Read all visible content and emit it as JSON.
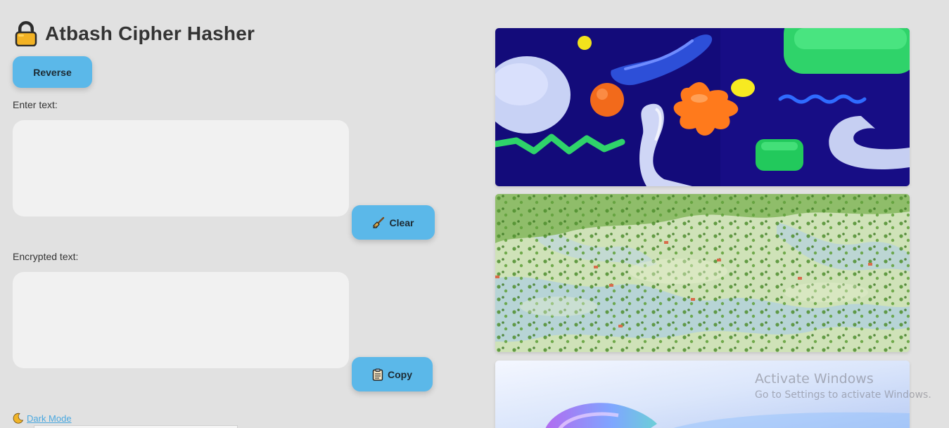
{
  "app": {
    "title": "Atbash Cipher Hasher",
    "icon": "lock-icon"
  },
  "buttons": {
    "reverse_label": "Reverse",
    "clear_label": "Clear",
    "clear_icon": "broom-icon",
    "copy_label": "Copy",
    "copy_icon": "clipboard-icon"
  },
  "input": {
    "label": "Enter text:",
    "value": "",
    "placeholder": ""
  },
  "output": {
    "label": "Encrypted text:",
    "value": "",
    "placeholder": ""
  },
  "dark_mode": {
    "icon": "moon-icon",
    "label": "Dark Mode"
  },
  "gallery": {
    "images": [
      {
        "name": "abstract-3d-shapes-image"
      },
      {
        "name": "landscape-hills-image"
      },
      {
        "name": "gradient-swirl-image"
      }
    ]
  },
  "watermark": {
    "title": "Activate Windows",
    "subtitle": "Go to Settings to activate Windows."
  },
  "colors": {
    "background": "#e1e1e1",
    "button": "#5bb8e9",
    "textbox": "#f1f1f1",
    "link": "#4aa8e0"
  }
}
